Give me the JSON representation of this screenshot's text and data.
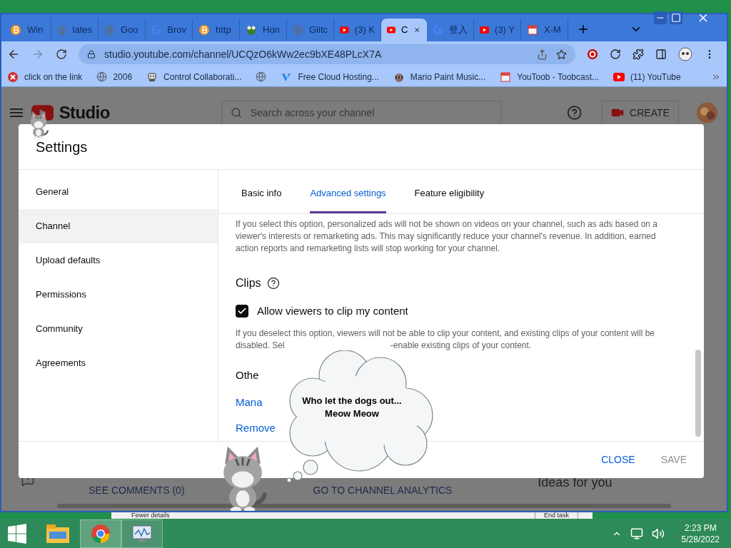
{
  "browser": {
    "tabs": [
      {
        "label": "Win",
        "kind": "bitcoin",
        "selected": false
      },
      {
        "label": "lates",
        "kind": "globe",
        "selected": false
      },
      {
        "label": "Goo",
        "kind": "globe",
        "selected": false
      },
      {
        "label": "Brov",
        "kind": "google",
        "selected": false
      },
      {
        "label": "http",
        "kind": "bitcoin",
        "selected": false
      },
      {
        "label": "Hon",
        "kind": "frog",
        "selected": false
      },
      {
        "label": "Glitc",
        "kind": "globe",
        "selected": false
      },
      {
        "label": "(3) K",
        "kind": "youtube",
        "selected": false
      },
      {
        "label": "C",
        "kind": "youtube",
        "selected": true
      },
      {
        "label": "登入",
        "kind": "google",
        "selected": false
      },
      {
        "label": "(3) Y",
        "kind": "youtube",
        "selected": false
      },
      {
        "label": "X-M",
        "kind": "page",
        "selected": false
      }
    ],
    "url": "studio.youtube.com/channel/UCQzO6kWw2ec9bXE48PLcX7A",
    "bookmarks": [
      {
        "label": "click on the link",
        "kind": "error"
      },
      {
        "label": "2006",
        "kind": "globe"
      },
      {
        "label": "Control Collaborati...",
        "kind": "robot"
      },
      {
        "kind": "globe"
      },
      {
        "label": "Free Cloud Hosting...",
        "kind": "v"
      },
      {
        "label": "Mario Paint Music...",
        "kind": "raccoon"
      },
      {
        "label": "YouToob - Toobcast...",
        "kind": "page"
      },
      {
        "label": "(11) YouTube",
        "kind": "youtube"
      }
    ]
  },
  "studio": {
    "logo": "Studio",
    "search_placeholder": "Search across your channel",
    "create": "CREATE",
    "bottom": [
      "SEE COMMENTS (0)",
      "GO TO CHANNEL ANALYTICS"
    ],
    "ideas": "Ideas for you"
  },
  "dialog": {
    "title": "Settings",
    "sidebar": [
      {
        "label": "General",
        "selected": false
      },
      {
        "label": "Channel",
        "selected": true
      },
      {
        "label": "Upload defaults",
        "selected": false
      },
      {
        "label": "Permissions",
        "selected": false
      },
      {
        "label": "Community",
        "selected": false
      },
      {
        "label": "Agreements",
        "selected": false
      }
    ],
    "tabs": [
      {
        "label": "Basic info",
        "selected": false
      },
      {
        "label": "Advanced settings",
        "selected": true
      },
      {
        "label": "Feature eligibility",
        "selected": false
      }
    ],
    "ads_note": "If you select this option, personalized ads will not be shown on videos on your channel, such as ads based on a viewer's interests or remarketing ads. This may significantly reduce your channel's revenue. In addition, earned action reports and remarketing lists will stop working for your channel.",
    "clips_heading": "Clips",
    "clip_checkbox": {
      "label": "Allow viewers to clip my content",
      "checked": true
    },
    "clips_note_line1": "If you deselect this option, viewers will not be able to clip your content, and existing clips of your content will be",
    "clips_note_start": "disabled. Sel",
    "clips_note_end": "-enable existing clips of your content.",
    "other_heading": "Othe",
    "links": [
      "Mana",
      "Remove"
    ],
    "buttons": [
      {
        "label": "CLOSE",
        "disabled": false
      },
      {
        "label": "SAVE",
        "disabled": true
      }
    ]
  },
  "cloud_text": [
    "Who let the dogs out...",
    "Meow Meow"
  ],
  "task_manager": {
    "left": "Fewer details",
    "right": "End task"
  },
  "taskbar": {
    "time": "2:23 PM",
    "date": "5/28/2022"
  }
}
